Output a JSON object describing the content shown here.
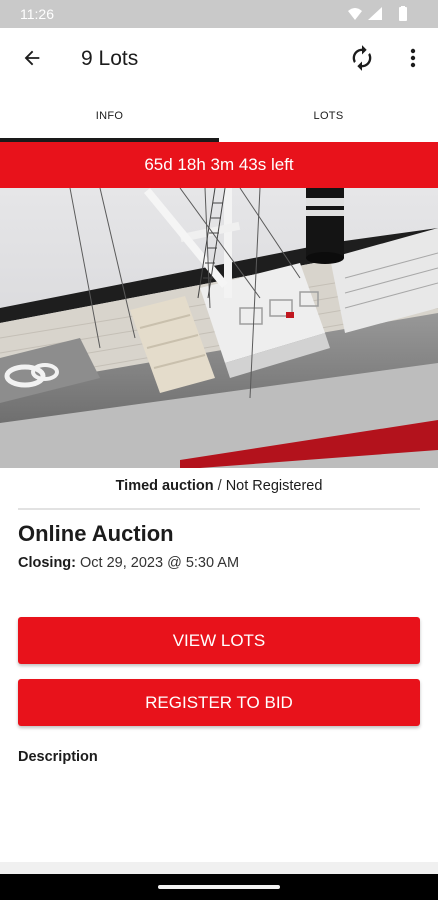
{
  "status_bar": {
    "time": "11:26",
    "icons": [
      "wifi-icon",
      "signal-icon",
      "battery-icon"
    ]
  },
  "app_bar": {
    "title": "9 Lots",
    "back_icon": "arrow-back-icon",
    "refresh_icon": "refresh-icon",
    "menu_icon": "more-vert-icon"
  },
  "tabs": [
    {
      "label": "INFO",
      "selected": true
    },
    {
      "label": "LOTS",
      "selected": false
    }
  ],
  "countdown": {
    "text": "65d 18h 3m 43s left"
  },
  "hero_image": {
    "subject": "model ship photo"
  },
  "auction": {
    "type": "Timed auction",
    "separator": " / ",
    "registration_status": "Not Registered",
    "name": "Online Auction",
    "closing_label": "Closing:",
    "closing_value": "Oct 29, 2023 @ 5:30 AM"
  },
  "buttons": {
    "view_lots": "VIEW LOTS",
    "register": "REGISTER TO BID"
  },
  "description": {
    "label": "Description"
  },
  "colors": {
    "accent_red": "#e8121b",
    "status_bar": "#c9c9c9",
    "text": "#1c1c1c"
  }
}
